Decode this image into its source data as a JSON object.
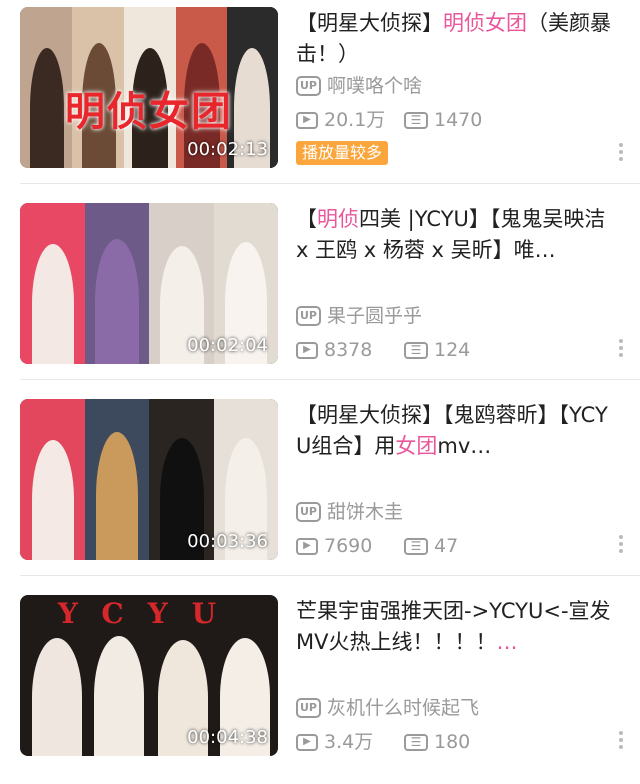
{
  "videos": [
    {
      "title_parts": [
        {
          "text": "【明星大侦探】",
          "hl": false
        },
        {
          "text": "明侦女团",
          "hl": true
        },
        {
          "text": "（美颜暴击！）",
          "hl": false
        }
      ],
      "thumb_text": "明侦女团",
      "duration": "00:02:13",
      "uploader": "啊噗咯个啥",
      "views": "20.1万",
      "comments": "1470",
      "badge": "播放量较多"
    },
    {
      "title_parts": [
        {
          "text": "【",
          "hl": false
        },
        {
          "text": "明侦",
          "hl": true
        },
        {
          "text": "四美 |YCYU】【鬼鬼吴映洁 x 王鸥 x 杨蓉 x 吴昕】唯…",
          "hl": false
        }
      ],
      "duration": "00:02:04",
      "uploader": "果子圆乎乎",
      "views": "8378",
      "comments": "124"
    },
    {
      "title_parts": [
        {
          "text": "【明星大侦探】【鬼鸥蓉昕】【YCYU组合】用",
          "hl": false
        },
        {
          "text": "女团",
          "hl": true
        },
        {
          "text": "mv…",
          "hl": false
        }
      ],
      "duration": "00:03:36",
      "uploader": "甜饼木圭",
      "views": "7690",
      "comments": "47"
    },
    {
      "title_parts": [
        {
          "text": "芒果宇宙强推天团->YCYU<-宣发MV火热上线！！！！",
          "hl": false
        },
        {
          "text": "…",
          "hl": true
        }
      ],
      "thumb_text": "YCYU",
      "duration": "00:04:38",
      "uploader": "灰机什么时候起飞",
      "views": "3.4万",
      "comments": "180"
    }
  ],
  "labels": {
    "up": "UP"
  }
}
